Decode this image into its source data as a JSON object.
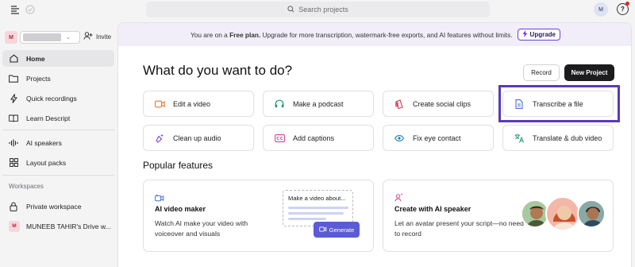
{
  "topbar": {
    "search_placeholder": "Search projects",
    "avatar_initial": "M",
    "help_label": "?"
  },
  "sidebar": {
    "workspace_initial": "M",
    "invite_label": "Invite",
    "nav": [
      {
        "label": "Home",
        "icon": "home-icon"
      },
      {
        "label": "Projects",
        "icon": "folder-icon"
      },
      {
        "label": "Quick recordings",
        "icon": "lightning-icon"
      },
      {
        "label": "Learn Descript",
        "icon": "book-icon"
      },
      {
        "label": "AI speakers",
        "icon": "waveform-icon"
      },
      {
        "label": "Layout packs",
        "icon": "grid-icon"
      }
    ],
    "workspaces_label": "Workspaces",
    "private_workspace": "Private workspace",
    "drive_initial": "M",
    "drive_label": "MUNEEB TAHIR's Drive w..."
  },
  "banner": {
    "prefix": "You are on a",
    "plan": "Free plan.",
    "suffix": "Upgrade for more transcription, watermark-free exports, and AI features without limits.",
    "upgrade_label": "Upgrade"
  },
  "main": {
    "heading": "What do you want to do?",
    "record_label": "Record",
    "new_project_label": "New Project",
    "actions": [
      {
        "label": "Edit a video",
        "icon": "video-camera-icon",
        "color": "#e8762c"
      },
      {
        "label": "Make a podcast",
        "icon": "headphones-icon",
        "color": "#1a9a6c"
      },
      {
        "label": "Create social clips",
        "icon": "social-clip-icon",
        "color": "#d9354b"
      },
      {
        "label": "Transcribe a file",
        "icon": "document-icon",
        "color": "#4a6fd6"
      },
      {
        "label": "Clean up audio",
        "icon": "sparkle-mic-icon",
        "color": "#7a3fd6"
      },
      {
        "label": "Add captions",
        "icon": "captions-icon",
        "color": "#d93f9c"
      },
      {
        "label": "Fix eye contact",
        "icon": "eye-icon",
        "color": "#1f7fb8"
      },
      {
        "label": "Translate & dub video",
        "icon": "translate-icon",
        "color": "#1a9a6c"
      }
    ],
    "popular_heading": "Popular features",
    "features": [
      {
        "title": "AI video maker",
        "desc": "Watch AI make your video with voiceover and visuals",
        "icon": "ai-video-icon",
        "mock_text": "Make a video about...",
        "generate_label": "Generate"
      },
      {
        "title": "Create with AI speaker",
        "desc": "Let an avatar present your script—no need to record",
        "icon": "ai-speaker-icon"
      }
    ]
  },
  "colors": {
    "accent_purple": "#5b3bb4",
    "generate_blue": "#5b5bd6",
    "banner_bg": "#f1eefa"
  }
}
